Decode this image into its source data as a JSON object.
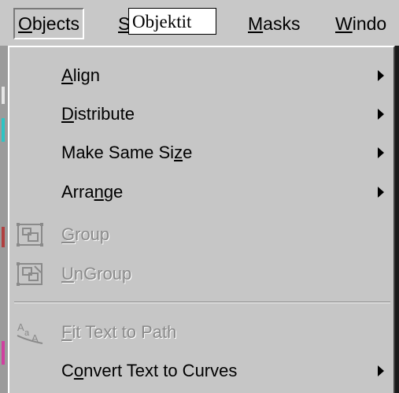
{
  "menubar": {
    "objects": "Objects",
    "hidden_partial": "S",
    "masks": "Masks",
    "window": "Windo"
  },
  "callout": {
    "text": "Objektit"
  },
  "menu": {
    "items": [
      {
        "label": "Align",
        "has_submenu": true,
        "enabled": true
      },
      {
        "label": "Distribute",
        "has_submenu": true,
        "enabled": true
      },
      {
        "label": "Make Same Size",
        "has_submenu": true,
        "enabled": true
      },
      {
        "label": "Arrange",
        "has_submenu": true,
        "enabled": true
      },
      {
        "label": "Group",
        "has_submenu": false,
        "enabled": false,
        "icon": "group-icon"
      },
      {
        "label": "UnGroup",
        "has_submenu": false,
        "enabled": false,
        "icon": "ungroup-icon"
      },
      {
        "label": "Fit Text to Path",
        "has_submenu": false,
        "enabled": false,
        "icon": "fit-text-to-path-icon"
      },
      {
        "label": "Convert Text to Curves",
        "has_submenu": true,
        "enabled": true
      }
    ]
  },
  "colors": {
    "menu_bg": "#c6c6c6",
    "disabled_text": "#8a8a8a"
  }
}
